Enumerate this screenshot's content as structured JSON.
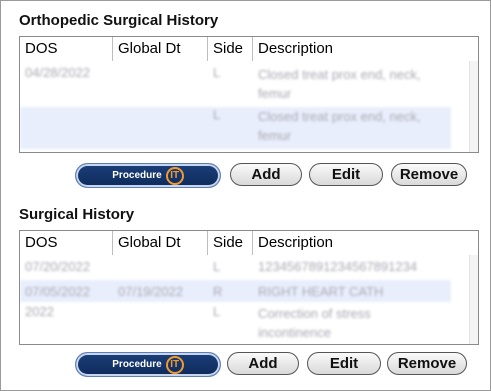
{
  "ortho": {
    "title": "Orthopedic Surgical History",
    "columns": [
      "DOS",
      "Global Dt",
      "Side",
      "Description"
    ],
    "rows": [
      {
        "dos": "04/28/2022",
        "global": "",
        "side": "L",
        "desc": "Closed treat prox end, neck, femur"
      },
      {
        "dos": "",
        "global": "",
        "side": "L",
        "desc": "Closed treat prox end, neck, femur"
      }
    ]
  },
  "surgical": {
    "title": "Surgical History",
    "columns": [
      "DOS",
      "Global Dt",
      "Side",
      "Description"
    ],
    "rows": [
      {
        "dos": "07/20/2022",
        "global": "",
        "side": "L",
        "desc": "1234567891234567891234"
      },
      {
        "dos": "07/05/2022",
        "global": "07/19/2022",
        "side": "R",
        "desc": "RIGHT HEART CATH"
      },
      {
        "dos": "2022",
        "global": "",
        "side": "L",
        "desc": "Correction of stress incontinence"
      }
    ]
  },
  "buttons": {
    "procedure_label": "Procedure",
    "procedure_logo": "IT",
    "add": "Add",
    "edit": "Edit",
    "remove": "Remove"
  }
}
